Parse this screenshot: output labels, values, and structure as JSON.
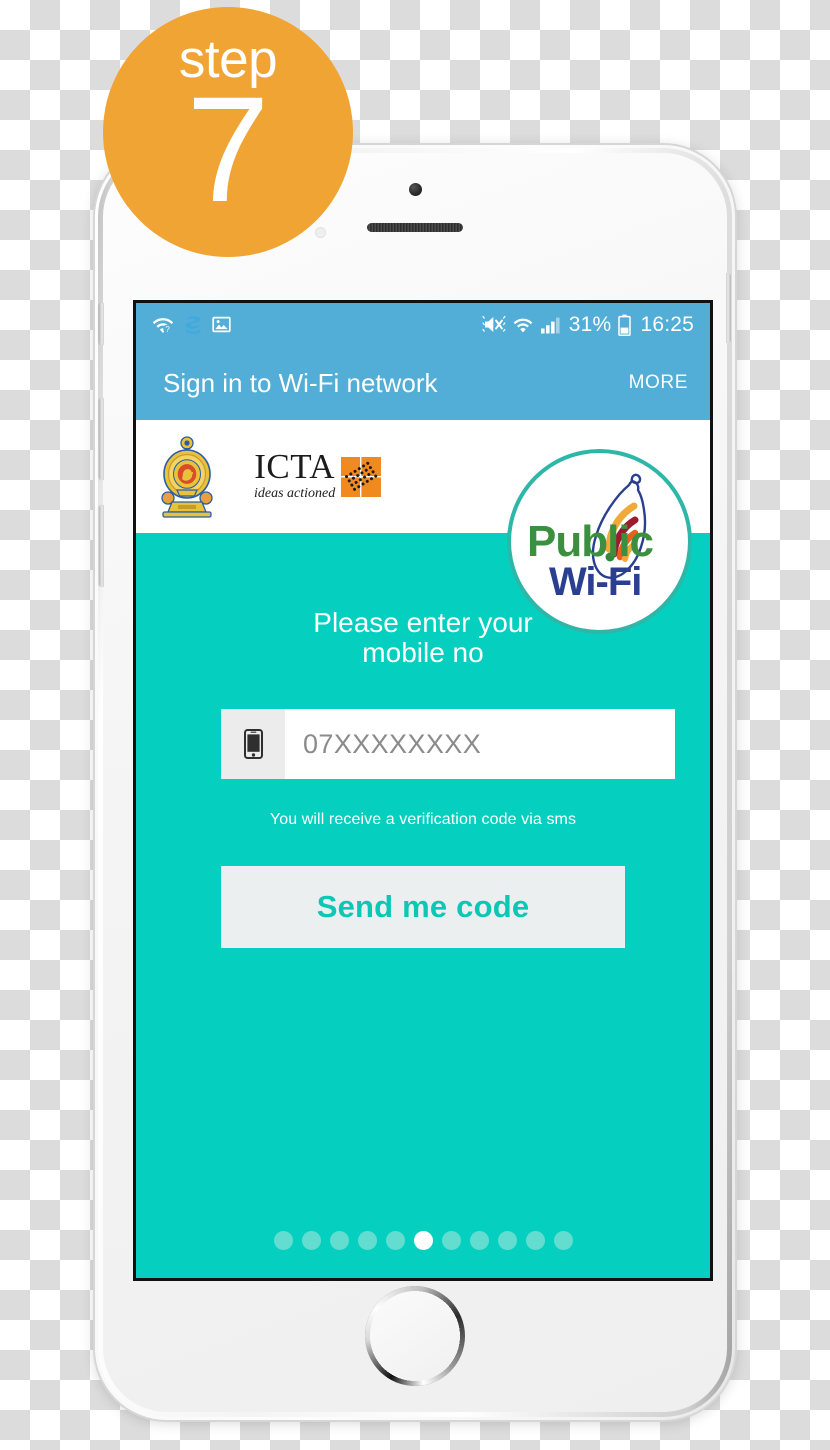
{
  "badge": {
    "word": "step",
    "number": "7",
    "color": "#F0A434"
  },
  "colors": {
    "appbar_blue": "#52AED6",
    "screen_teal": "#05D0BF",
    "button_bg": "#ECEFEF",
    "button_text": "#0BC7B5",
    "badge_orange": "#F0A434"
  },
  "statusbar": {
    "left_icons": [
      "wifi-question-icon",
      "s-health-icon",
      "image-icon"
    ],
    "right_icons": [
      "mute-vibrate-icon",
      "wifi-icon",
      "cellular-signal-icon",
      "battery-icon"
    ],
    "battery_percent": "31%",
    "clock": "16:25"
  },
  "appbar": {
    "title": "Sign in to Wi-Fi network",
    "more_label": "MORE"
  },
  "branding": {
    "emblem_name": "sri-lanka-government-emblem",
    "icta_word": "ICTA",
    "icta_tagline": "ideas actioned",
    "public_wifi_top": "Public",
    "public_wifi_bottom": "Wi-Fi"
  },
  "form": {
    "prompt_line1": "Please enter your",
    "prompt_line2": "mobile no",
    "input_value": "",
    "input_placeholder": "07XXXXXXXX",
    "helper_text": "You will receive a verification code via sms",
    "submit_label": "Send me code"
  },
  "pagination": {
    "total": 11,
    "active_index": 5
  }
}
